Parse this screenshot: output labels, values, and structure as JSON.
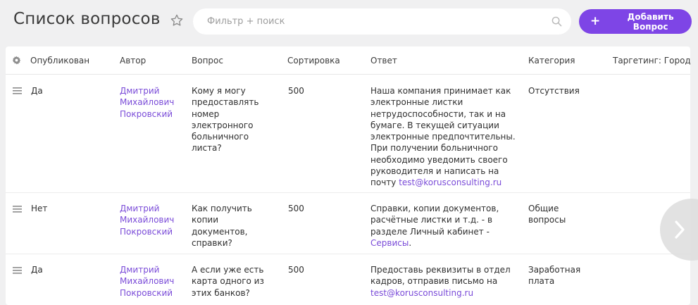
{
  "header": {
    "title": "Список вопросов",
    "search_placeholder": "Фильтр + поиск",
    "add_button_label": "Добавить Вопрос"
  },
  "table": {
    "columns": {
      "published": "Опубликован",
      "author": "Автор",
      "question": "Вопрос",
      "sort": "Сортировка",
      "answer": "Ответ",
      "category": "Категория",
      "targeting": "Таргетинг: Город"
    },
    "rows": [
      {
        "published": "Да",
        "author": [
          "Дмитрий",
          "Михайлович",
          "Покровский"
        ],
        "question": [
          "Кому я могу",
          "предоставлять",
          "номер",
          "электронного",
          "больничного",
          "листа?"
        ],
        "sort": "500",
        "answer_lines": [
          "Наша компания принимает как",
          "электронные листки",
          "нетрудоспособности, так и на",
          "бумаге. В текущей ситуации",
          "электронные предпочтительны.",
          "При получении больничного",
          "необходимо уведомить своего",
          "руководителя и написать на"
        ],
        "answer_tail_prefix": "почту ",
        "answer_link": "test@korusconsulting.ru",
        "category": [
          "Отсутствия"
        ]
      },
      {
        "published": "Нет",
        "author": [
          "Дмитрий",
          "Михайлович",
          "Покровский"
        ],
        "question": [
          "Как получить",
          "копии",
          "документов,",
          "справки?"
        ],
        "sort": "500",
        "answer_lines": [
          "Справки, копии документов,",
          "расчётные листки и т.д. - в",
          "разделе Личный кабинет -"
        ],
        "answer_tail_prefix": "",
        "answer_link": "Сервисы",
        "answer_tail_suffix": ".",
        "category": [
          "Общие",
          "вопросы"
        ]
      },
      {
        "published": "Да",
        "author": [
          "Дмитрий",
          "Михайлович",
          "Покровский"
        ],
        "question": [
          "А если уже есть",
          "карта одного из",
          "этих банков?"
        ],
        "sort": "500",
        "answer_lines": [
          "Предоставь реквизиты в отдел",
          "кадров, отправив письмо на"
        ],
        "answer_tail_prefix": "",
        "answer_link": "test@korusconsulting.ru",
        "category": [
          "Заработная",
          "плата"
        ]
      }
    ]
  },
  "icons": {
    "favorite": "star-icon",
    "search": "search-icon",
    "add": "plus-icon",
    "settings": "gear-icon",
    "drag": "drag-handle-icon",
    "next": "chevron-right-icon"
  },
  "colors": {
    "accent": "#7e45e6",
    "link": "#7a4bd8",
    "background": "#f0f0f1"
  }
}
